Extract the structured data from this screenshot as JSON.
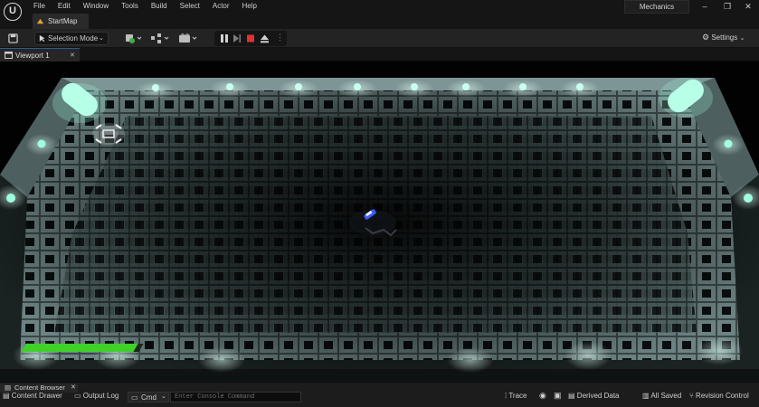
{
  "window": {
    "menu": [
      "File",
      "Edit",
      "Window",
      "Tools",
      "Build",
      "Select",
      "Actor",
      "Help"
    ],
    "map_tab": "StartMap",
    "project_name": "Mechanics",
    "controls": {
      "minimize": "–",
      "maximize": "❐",
      "close": "✕"
    }
  },
  "toolbar": {
    "selection_mode": "Selection Mode",
    "settings": "Settings",
    "icons": [
      "save-icon",
      "add-actor-icon",
      "blueprint-icon",
      "cinematics-icon",
      "pause-icon",
      "step-icon",
      "stop-icon",
      "eject-icon",
      "more-icon"
    ]
  },
  "viewport": {
    "tab_label": "Viewport 1",
    "tab_close": "✕",
    "health_level": 0.95,
    "colors": {
      "floor_dark": "#0b0f10",
      "floor_lit": "#8fb3b3",
      "glow": "#9effe0",
      "health": "#3fd02a",
      "player": "#3a5bff"
    }
  },
  "bottombar": {
    "content_browser": "Content Browser",
    "content_drawer": "Content Drawer",
    "output_log": "Output Log",
    "cmd": "Cmd",
    "console_placeholder": "Enter Console Command",
    "trace": "Trace",
    "derived_data": "Derived Data",
    "all_saved": "All Saved",
    "revision_control": "Revision Control"
  }
}
